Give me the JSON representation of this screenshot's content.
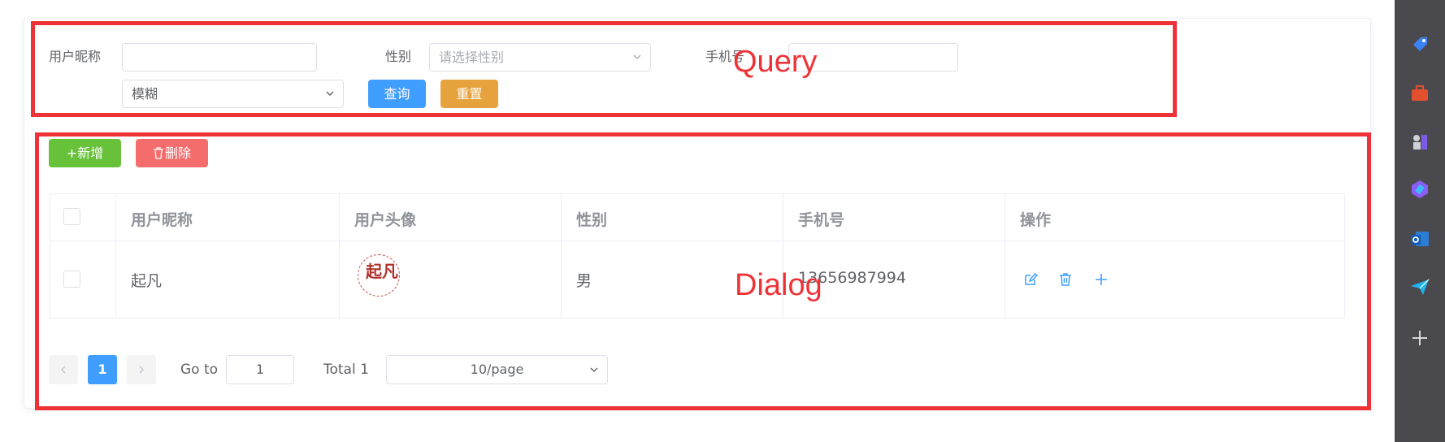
{
  "query_form": {
    "nickname_label": "用户昵称",
    "nickname_value": "",
    "gender_label": "性别",
    "gender_placeholder": "请选择性别",
    "phone_label": "手机号",
    "phone_value": "",
    "match_mode": "模糊",
    "search_label": "查询",
    "reset_label": "重置"
  },
  "toolbar": {
    "add_label": "+新增",
    "delete_label": "删除"
  },
  "table": {
    "headers": [
      "用户昵称",
      "用户头像",
      "性别",
      "手机号",
      "操作"
    ],
    "rows": [
      {
        "nickname": "起凡",
        "avatar_text": "起凡",
        "gender": "男",
        "phone": "13656987994"
      }
    ]
  },
  "pagination": {
    "current_page": "1",
    "goto_label": "Go to",
    "goto_value": "1",
    "total_label": "Total 1",
    "page_size": "10/page"
  },
  "annotations": {
    "query": "Query",
    "dialog": "Dialog"
  },
  "colors": {
    "primary": "#409eff",
    "warning": "#e6a23c",
    "success": "#67c23a",
    "danger": "#f56c6c",
    "annotation_red": "#ee3338"
  }
}
